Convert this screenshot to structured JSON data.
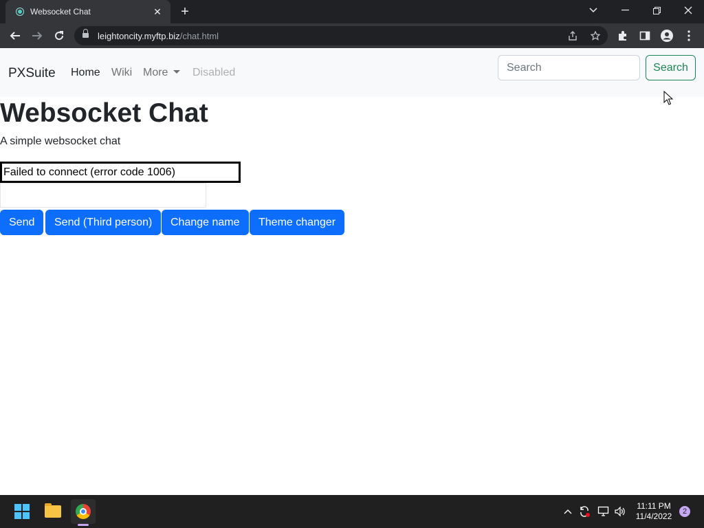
{
  "browser": {
    "tab_title": "Websocket Chat",
    "tab_close": "✕",
    "new_tab": "+",
    "url_host": "leightoncity.myftp.biz",
    "url_path": "/chat.html"
  },
  "navbar": {
    "brand": "PXSuite",
    "links": [
      {
        "label": "Home",
        "state": "active"
      },
      {
        "label": "Wiki",
        "state": "normal"
      },
      {
        "label": "More",
        "state": "dropdown"
      },
      {
        "label": "Disabled",
        "state": "disabled"
      }
    ],
    "search_placeholder": "Search",
    "search_button": "Search"
  },
  "main": {
    "title": "Websocket Chat",
    "lead": "A simple websocket chat",
    "status_message": "Failed to connect (error code 1006)",
    "message_input_value": "",
    "buttons": [
      "Send",
      "Send (Third person)",
      "Change name",
      "Theme changer"
    ]
  },
  "taskbar": {
    "time": "11:11 PM",
    "date": "11/4/2022",
    "notification_count": "2"
  },
  "colors": {
    "primary": "#0d6efd",
    "success": "#198754",
    "chrome_dark": "#202124",
    "taskbar": "#202020"
  }
}
